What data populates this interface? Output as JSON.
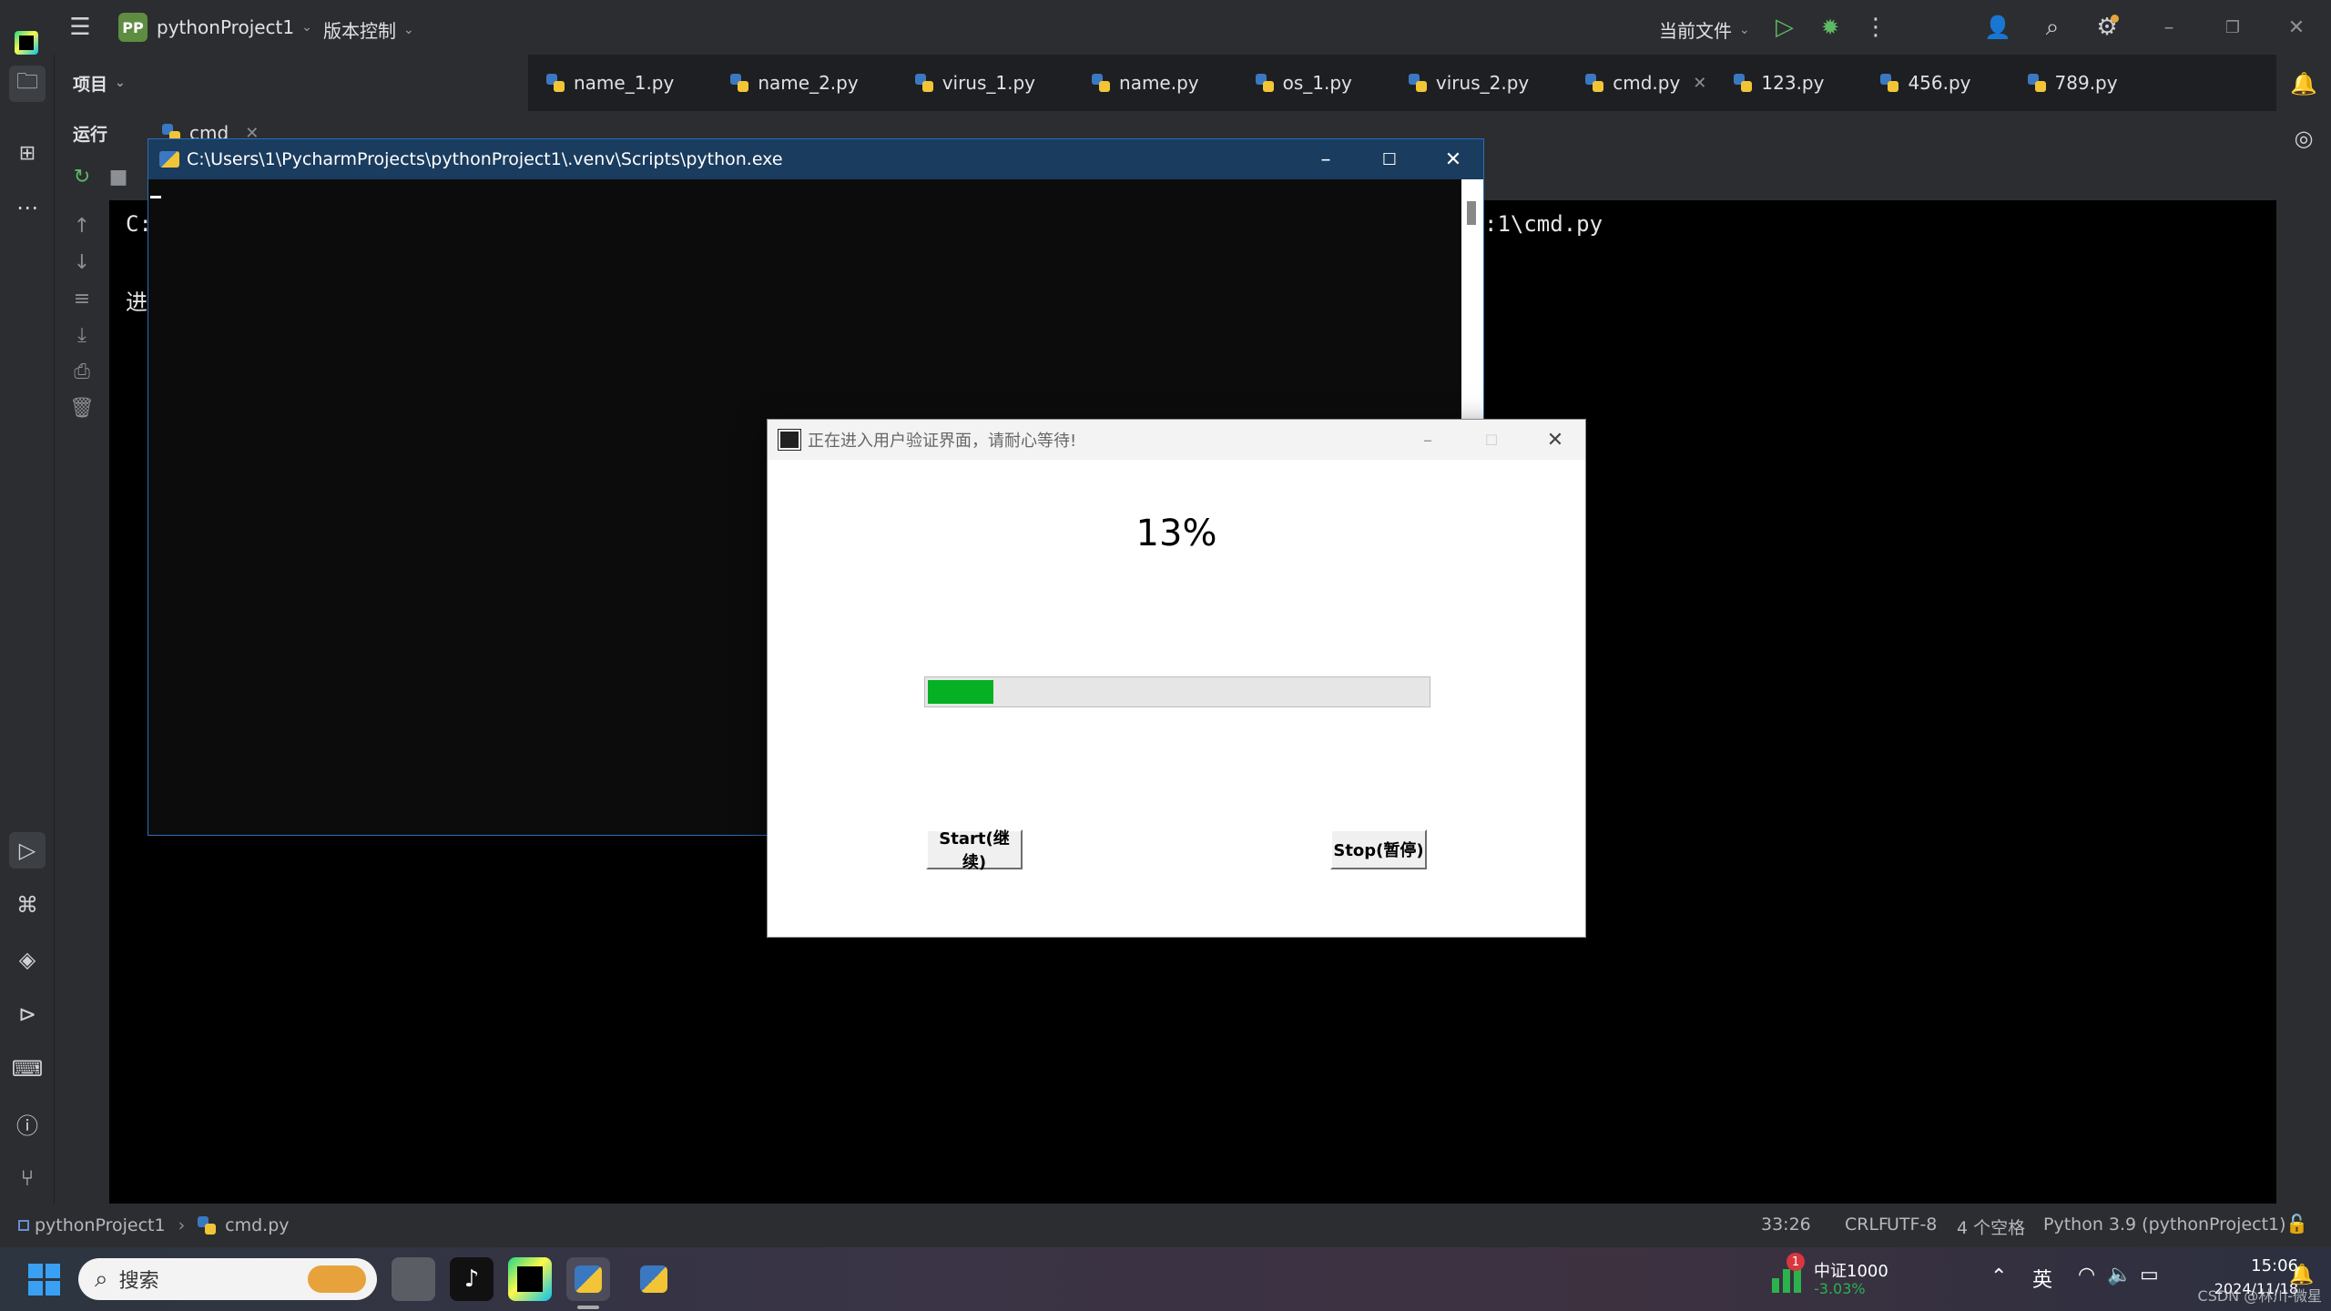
{
  "titlebar": {
    "project_badge": "PP",
    "project_name": "pythonProject1",
    "vcs_label": "版本控制",
    "run_config": "当前文件"
  },
  "project_panel": {
    "label": "项目"
  },
  "tabs": [
    {
      "label": "name_1.py"
    },
    {
      "label": "name_2.py"
    },
    {
      "label": "virus_1.py"
    },
    {
      "label": "name.py"
    },
    {
      "label": "os_1.py"
    },
    {
      "label": "virus_2.py"
    },
    {
      "label": "cmd.py",
      "active": true
    },
    {
      "label": "123.py"
    },
    {
      "label": "456.py"
    },
    {
      "label": "789.py"
    }
  ],
  "run_panel": {
    "title": "运行",
    "tab_label": "cmd"
  },
  "console": {
    "line1_prefix": "C:",
    "line1_suffix": ":1\\cmd.py",
    "line2_prefix": "进"
  },
  "cmd_window": {
    "title": "C:\\Users\\1\\PycharmProjects\\pythonProject1\\.venv\\Scripts\\python.exe"
  },
  "dialog": {
    "title": "正在进入用户验证界面，请耐心等待!",
    "percent_text": "13%",
    "progress": 0.13,
    "start_label": "Start(继续)",
    "stop_label": "Stop(暂停)",
    "progress_color": "#06b025"
  },
  "statusbar": {
    "project": "pythonProject1",
    "file": "cmd.py",
    "position": "33:26",
    "line_sep": "CRLF",
    "encoding": "UTF-8",
    "indent": "4 个空格",
    "interpreter": "Python 3.9 (pythonProject1)"
  },
  "taskbar": {
    "search_placeholder": "搜索",
    "stock_name": "中证1000",
    "stock_change": "-3.03%",
    "stock_badge": "1",
    "ime": "英",
    "time": "15:06",
    "date": "2024/11/18",
    "watermark": "CSDN @林川-微星"
  }
}
